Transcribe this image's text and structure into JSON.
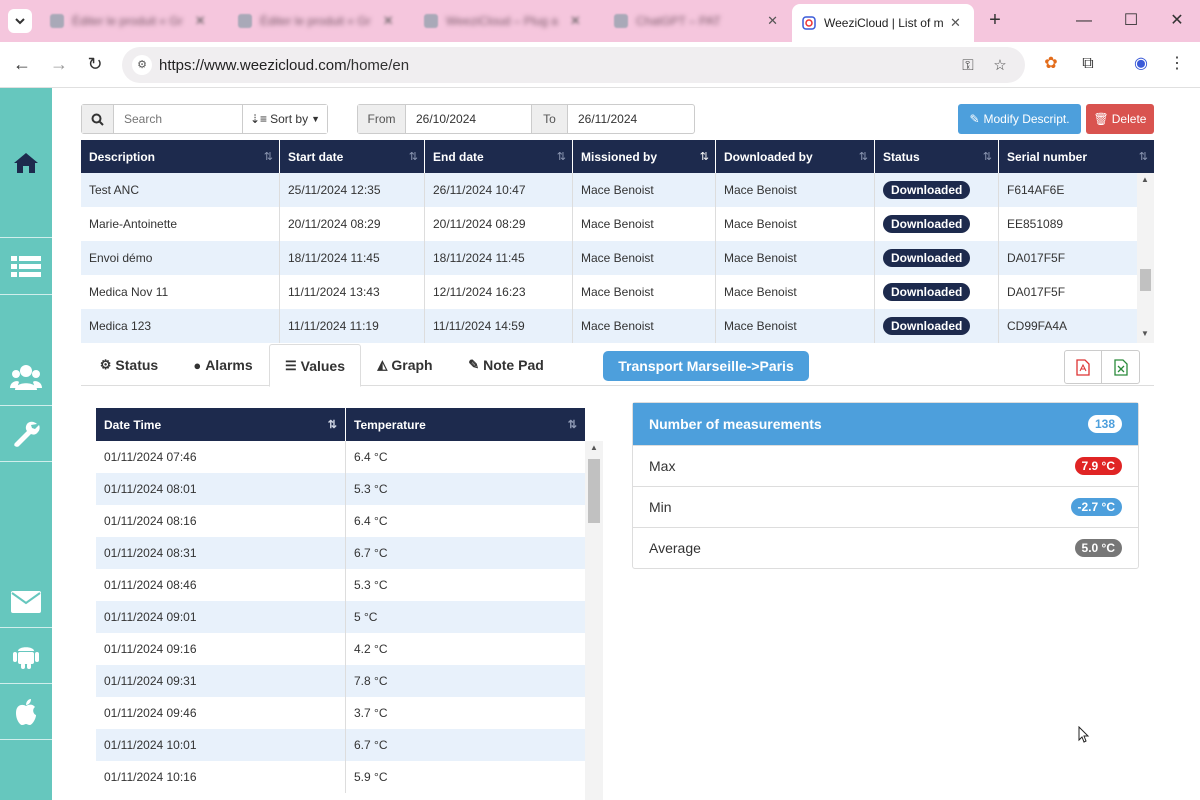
{
  "browser": {
    "tabs": [
      {
        "label": "Éditer le produit « Gr"
      },
      {
        "label": "Éditer le produit « Gr"
      },
      {
        "label": "WeeziCloud – Plug a"
      },
      {
        "label": "ChatGPT – PAT"
      }
    ],
    "active_tab": {
      "label": "WeeziCloud | List of m"
    },
    "url_host": "https://www.weezicloud.com",
    "url_path": "/home/en"
  },
  "toolbar": {
    "search_placeholder": "Search",
    "sort_label": "Sort by",
    "from_label": "From",
    "from_value": "26/10/2024",
    "to_label": "To",
    "to_value": "26/11/2024",
    "modify_label": "Modify Descript.",
    "delete_label": "Delete"
  },
  "missions_table": {
    "columns": [
      "Description",
      "Start date",
      "End date",
      "Missioned by",
      "Downloaded by",
      "Status",
      "Serial number"
    ],
    "rows": [
      {
        "description": "Test ANC",
        "start": "25/11/2024 12:35",
        "end": "26/11/2024 10:47",
        "missioned_by": "Mace Benoist",
        "downloaded_by": "Mace Benoist",
        "status": "Downloaded",
        "serial": "F614AF6E"
      },
      {
        "description": "Marie-Antoinette",
        "start": "20/11/2024 08:29",
        "end": "20/11/2024 08:29",
        "missioned_by": "Mace Benoist",
        "downloaded_by": "Mace Benoist",
        "status": "Downloaded",
        "serial": "EE851089"
      },
      {
        "description": "Envoi démo",
        "start": "18/11/2024 11:45",
        "end": "18/11/2024 11:45",
        "missioned_by": "Mace Benoist",
        "downloaded_by": "Mace Benoist",
        "status": "Downloaded",
        "serial": "DA017F5F"
      },
      {
        "description": "Medica Nov 11",
        "start": "11/11/2024 13:43",
        "end": "12/11/2024 16:23",
        "missioned_by": "Mace Benoist",
        "downloaded_by": "Mace Benoist",
        "status": "Downloaded",
        "serial": "DA017F5F"
      },
      {
        "description": "Medica 123",
        "start": "11/11/2024 11:19",
        "end": "11/11/2024 14:59",
        "missioned_by": "Mace Benoist",
        "downloaded_by": "Mace Benoist",
        "status": "Downloaded",
        "serial": "CD99FA4A"
      }
    ]
  },
  "tabs": {
    "status": "Status",
    "alarms": "Alarms",
    "values": "Values",
    "graph": "Graph",
    "notepad": "Note Pad",
    "transport": "Transport Marseille->Paris"
  },
  "values_table": {
    "columns": [
      "Date Time",
      "Temperature"
    ],
    "rows": [
      {
        "datetime": "01/11/2024 07:46",
        "temp": "6.4 °C"
      },
      {
        "datetime": "01/11/2024 08:01",
        "temp": "5.3 °C"
      },
      {
        "datetime": "01/11/2024 08:16",
        "temp": "6.4 °C"
      },
      {
        "datetime": "01/11/2024 08:31",
        "temp": "6.7 °C"
      },
      {
        "datetime": "01/11/2024 08:46",
        "temp": "5.3 °C"
      },
      {
        "datetime": "01/11/2024 09:01",
        "temp": "5 °C"
      },
      {
        "datetime": "01/11/2024 09:16",
        "temp": "4.2 °C"
      },
      {
        "datetime": "01/11/2024 09:31",
        "temp": "7.8 °C"
      },
      {
        "datetime": "01/11/2024 09:46",
        "temp": "3.7 °C"
      },
      {
        "datetime": "01/11/2024 10:01",
        "temp": "6.7 °C"
      },
      {
        "datetime": "01/11/2024 10:16",
        "temp": "5.9 °C"
      }
    ]
  },
  "stats": {
    "title": "Number of measurements",
    "count": "138",
    "max_label": "Max",
    "max_value": "7.9 °C",
    "min_label": "Min",
    "min_value": "-2.7 °C",
    "avg_label": "Average",
    "avg_value": "5.0 °C"
  },
  "colors": {
    "sidebar": "#66c7be",
    "header_navy": "#1d2a4d",
    "primary": "#4d9fdc",
    "danger": "#d9534f"
  }
}
